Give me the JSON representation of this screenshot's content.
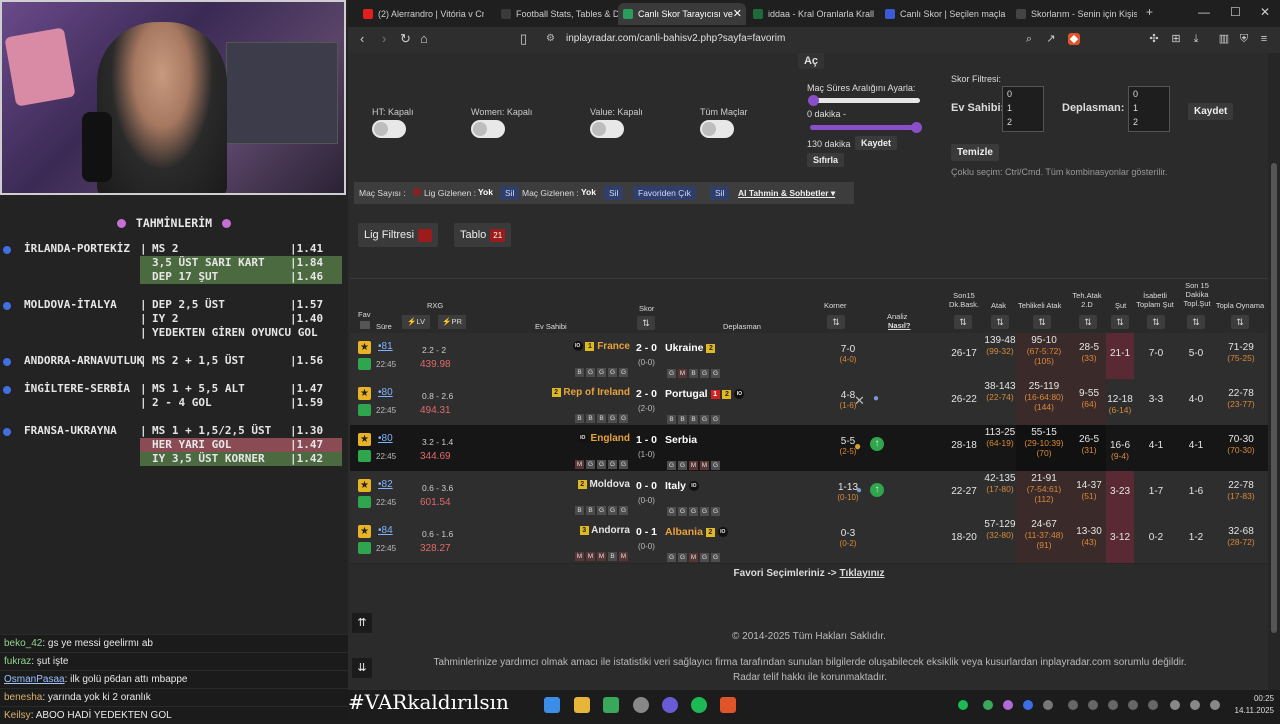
{
  "predictions": {
    "title": "TAHMİNLERİM",
    "groups": [
      {
        "team": "İRLANDA-PORTEKİZ",
        "lines": [
          {
            "bet": "MS 2",
            "odd": "|1.41",
            "hl": ""
          },
          {
            "bet": "3,5 ÜST SARI KART",
            "odd": "|1.84",
            "hl": "green"
          },
          {
            "bet": "DEP 17 ŞUT",
            "odd": "|1.46",
            "hl": "green"
          }
        ]
      },
      {
        "team": "MOLDOVA-İTALYA",
        "lines": [
          {
            "bet": "DEP 2,5 ÜST",
            "odd": "|1.57",
            "hl": ""
          },
          {
            "bet": "IY 2",
            "odd": "|1.40",
            "hl": ""
          },
          {
            "bet": "YEDEKTEN GİREN OYUNCU GOL",
            "odd": "",
            "hl": ""
          }
        ]
      },
      {
        "team": "ANDORRA-ARNAVUTLUK",
        "lines": [
          {
            "bet": "MS 2 + 1,5 ÜST",
            "odd": "|1.56",
            "hl": ""
          }
        ]
      },
      {
        "team": "İNGİLTERE-SERBİA",
        "lines": [
          {
            "bet": "MS 1 + 5,5 ALT",
            "odd": "|1.47",
            "hl": ""
          },
          {
            "bet": "2 - 4 GOL",
            "odd": "|1.59",
            "hl": ""
          }
        ]
      },
      {
        "team": "FRANSA-UKRAYNA",
        "lines": [
          {
            "bet": "MS 1 + 1,5/2,5 ÜST",
            "odd": "|1.30",
            "hl": ""
          },
          {
            "bet": "HER YARI GOL",
            "odd": "|1.47",
            "hl": "red"
          },
          {
            "bet": "IY 3,5 ÜST KORNER",
            "odd": "|1.42",
            "hl": "green"
          }
        ]
      }
    ]
  },
  "chat": [
    {
      "user": "beko_42",
      "msg": ": gs ye messi geelirmı ab"
    },
    {
      "user": "fukraz",
      "msg": ": şut işte"
    },
    {
      "user": "OsmanPasaa",
      "msg": ": ilk golü p6dan attı mbappe"
    },
    {
      "user": "benesha",
      "msg": ": yarında yok ki 2 oranlık"
    },
    {
      "user": "Keilsy",
      "msg": ": ABOO HADİ YEDEKTEN GOL"
    }
  ],
  "browser": {
    "tabs": [
      {
        "label": "(2) Alerrandro | Vitória v Cr",
        "color": "#e02020"
      },
      {
        "label": "Football Stats, Tables & Dat",
        "color": "#3a3a3a"
      },
      {
        "label": "Canlı Skor Tarayıcısı ve",
        "color": "#2a9d5a"
      },
      {
        "label": "iddaa - Kral Oranlarla Kralla",
        "color": "#1f6a3a"
      },
      {
        "label": "Canlı Skor | Seçilen maçlar",
        "color": "#3b5bd6"
      },
      {
        "label": "Skorlarım - Senin için Kişis",
        "color": "#444"
      }
    ],
    "url": "inplayradar.com/canli-bahisv2.php?sayfa=favorim"
  },
  "controls": {
    "ac": "Aç",
    "toggles": [
      "HT: Kapalı",
      "Women: Kapalı",
      "Value: Kapalı",
      "Tüm Maçlar"
    ],
    "time_title": "Maç Süres Aralığını Ayarla:",
    "time_from": "0 dakika -",
    "time_to": "130 dakika",
    "save": "Kaydet",
    "reset": "Sıfırla",
    "score_filter": "Skor Filtresi:",
    "home_label": "Ev Sahibi:",
    "away_label": "Deplasman:",
    "score_opts": [
      "0",
      "1",
      "2"
    ],
    "score_save": "Kaydet",
    "clear": "Temizle",
    "hint": "Çoklu seçim: Ctrl/Cmd. Tüm kombinasyonlar gösterilir.",
    "filterbar": {
      "count_label": "Maç Sayısı :",
      "league_hidden": "Lig Gizlenen :",
      "yok1": "Yok",
      "sil1": "Sil",
      "match_hidden": "Maç Gizlenen :",
      "yok2": "Yok",
      "sil2": "Sil",
      "fav_out": "Favoriden Çık",
      "sil3": "Sil",
      "ai": "AI Tahmin & Sohbetler"
    },
    "league_filter": "Lig Filtresi",
    "table_btn": "Tablo",
    "table_count": "21"
  },
  "table": {
    "headers": {
      "fav": "Fav",
      "sure": "Süre",
      "rxg": "RXG",
      "lv": "LV",
      "pr": "PR",
      "home": "Ev Sahibi",
      "skor": "Skor",
      "away": "Deplasman",
      "korner": "Korner",
      "analiz": "Analiz",
      "nasil": "Nasıl?",
      "son15": "Son15 Dk.Bask.",
      "atak": "Atak",
      "tehlikeli": "Tehlikeli Atak",
      "tehatak": "Teh.Atak 2.D",
      "sut": "Şut",
      "isabetli": "İsabetli Toplam Şut",
      "son15sut": "Son 15 Dakika Topl.Şut",
      "topla": "Topla Oynama"
    },
    "rows": [
      {
        "minute": "81",
        "ko": "22:45",
        "xg": "2.2 - 2",
        "pr": "439.98",
        "home": "France",
        "home_yc": "1",
        "home_form": [
          "B",
          "G",
          "G",
          "G",
          "G"
        ],
        "score": "2 - 0",
        "ht": "(0-0)",
        "away": "Ukraine",
        "away_yc": "2",
        "away_form": [
          "G",
          "M",
          "B",
          "G",
          "G"
        ],
        "corner": "7-0",
        "corner_ht": "(4-0)",
        "son15": "26-17",
        "atak": "139-48",
        "atak2": "(99-32)",
        "teh": "95-10",
        "teh2": "(67-5:72)",
        "teh3": "(105)",
        "teh2d": "28-5",
        "teh2d2": "(33)",
        "sut": "21-1",
        "isa": "7-0",
        "s15": "5-0",
        "topla": "71-29",
        "topla2": "(75-25)"
      },
      {
        "minute": "80",
        "ko": "22:45",
        "xg": "0.8 - 2.6",
        "pr": "494.31",
        "home": "Rep of Ireland",
        "home_yc": "2",
        "home_form": [
          "B",
          "B",
          "B",
          "G",
          "G"
        ],
        "score": "2 - 0",
        "ht": "(2-0)",
        "away": "Portugal",
        "away_rc": "1",
        "away_yc": "2",
        "away_form": [
          "B",
          "B",
          "B",
          "G",
          "G"
        ],
        "corner": "4-8",
        "corner_ht": "(1-6)",
        "son15": "26-22",
        "atak": "38-143",
        "atak2": "(22-74)",
        "teh": "25-119",
        "teh2": "(16-64:80)",
        "teh3": "(144)",
        "teh2d": "9-55",
        "teh2d2": "(64)",
        "sut": "12-18",
        "sut2": "(6-14)",
        "isa": "3-3",
        "s15": "4-0",
        "topla": "22-78",
        "topla2": "(23-77)"
      },
      {
        "minute": "80",
        "ko": "22:45",
        "xg": "3.2 - 1.4",
        "pr": "344.69",
        "home": "England",
        "home_form": [
          "M",
          "G",
          "G",
          "G",
          "G"
        ],
        "score": "1 - 0",
        "ht": "(1-0)",
        "away": "Serbia",
        "away_form": [
          "G",
          "G",
          "M",
          "M",
          "G"
        ],
        "corner": "5-5",
        "corner_ht": "(2-5)",
        "son15": "28-18",
        "atak": "113-25",
        "atak2": "(64-19)",
        "teh": "55-15",
        "teh2": "(29-10:39)",
        "teh3": "(70)",
        "teh2d": "26-5",
        "teh2d2": "(31)",
        "sut": "16-6",
        "sut2": "(9-4)",
        "isa": "4-1",
        "s15": "4-1",
        "topla": "70-30",
        "topla2": "(70-30)"
      },
      {
        "minute": "82",
        "ko": "22:45",
        "xg": "0.6 - 3.6",
        "pr": "601.54",
        "home": "Moldova",
        "home_yc": "2",
        "home_form": [
          "B",
          "B",
          "G",
          "G",
          "G"
        ],
        "score": "0 - 0",
        "ht": "(0-0)",
        "away": "Italy",
        "away_form": [
          "G",
          "G",
          "G",
          "G",
          "G"
        ],
        "corner": "1-13",
        "corner_ht": "(0-10)",
        "son15": "22-27",
        "atak": "42-135",
        "atak2": "(17-80)",
        "teh": "21-91",
        "teh2": "(7-54:61)",
        "teh3": "(112)",
        "teh2d": "14-37",
        "teh2d2": "(51)",
        "sut": "3-23",
        "isa": "1-7",
        "s15": "1-6",
        "topla": "22-78",
        "topla2": "(17-83)"
      },
      {
        "minute": "84",
        "ko": "22:45",
        "xg": "0.6 - 1.6",
        "pr": "328.27",
        "home": "Andorra",
        "home_yc": "3",
        "home_form": [
          "M",
          "M",
          "M",
          "B",
          "M"
        ],
        "score": "0 - 1",
        "ht": "(0-0)",
        "away": "Albania",
        "away_yc": "2",
        "away_form": [
          "G",
          "G",
          "M",
          "G",
          "G"
        ],
        "corner": "0-3",
        "corner_ht": "(0-2)",
        "son15": "18-20",
        "atak": "57-129",
        "atak2": "(32-80)",
        "teh": "24-67",
        "teh2": "(11-37:48)",
        "teh3": "(91)",
        "teh2d": "13-30",
        "teh2d2": "(43)",
        "sut": "3-12",
        "isa": "0-2",
        "s15": "1-2",
        "topla": "32-68",
        "topla2": "(28-72)"
      }
    ]
  },
  "footer": {
    "fav_text": "Favori Seçimleriniz ->",
    "fav_link": "Tıklayınız",
    "copyright": "© 2014-2025 Tüm Hakları Saklıdır.",
    "disclaimer1": "Tahminlerinize yardımcı olmak amacı ile istatistiki veri sağlayıcı firma tarafından sunulan bilgilerde oluşabilecek eksiklik veya kusurlardan inplayradar.com sorumlu değildir.",
    "disclaimer2": "Radar telif hakkı ile korunmaktadır."
  },
  "taskbar": {
    "banner": "#VARkaldırılsın",
    "time": "00:25",
    "date": "14.11.2025"
  }
}
